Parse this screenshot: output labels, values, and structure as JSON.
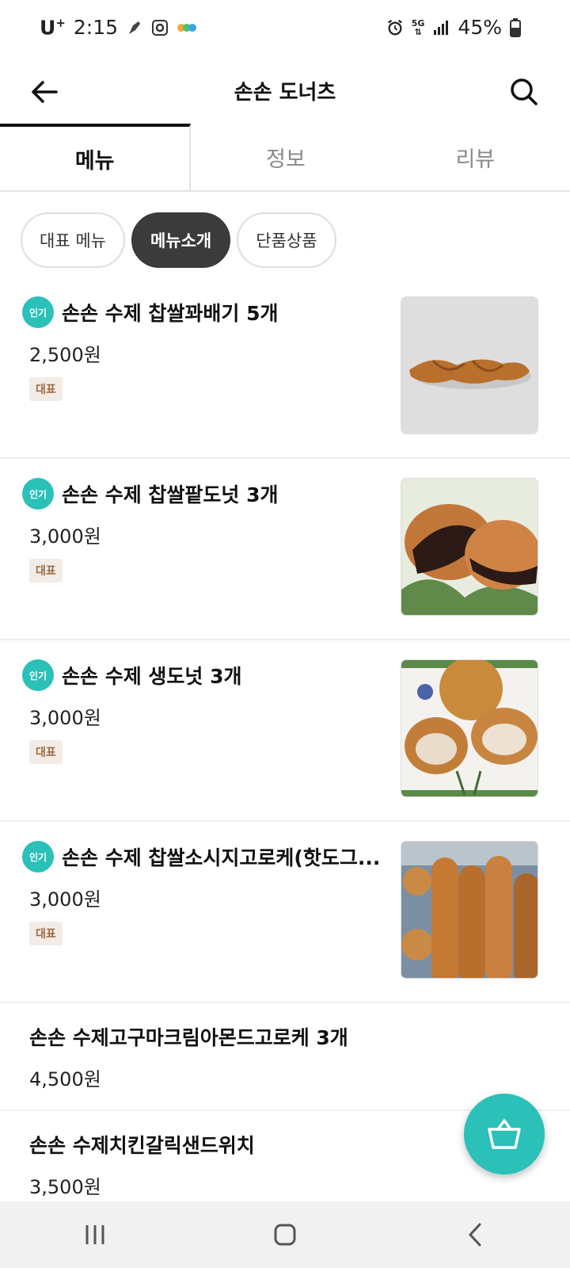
{
  "status_bar": {
    "carrier": "U",
    "carrier_sup": "+",
    "time": "2:15",
    "network": "5G",
    "battery": "45%"
  },
  "header": {
    "title": "손손 도너츠",
    "back_icon": "arrow-left-icon",
    "search_icon": "search-icon"
  },
  "tabs": [
    {
      "label": "메뉴",
      "active": true
    },
    {
      "label": "정보",
      "active": false
    },
    {
      "label": "리뷰",
      "active": false
    }
  ],
  "chips": [
    {
      "label": "대표 메뉴",
      "active": false
    },
    {
      "label": "메뉴소개",
      "active": true
    },
    {
      "label": "단품상품",
      "active": false
    }
  ],
  "popular_label": "인기",
  "representative_label": "대표",
  "menu": [
    {
      "name": "손손 수제 찹쌀꽈배기 5개",
      "price": "2,500원"
    },
    {
      "name": "손손 수제 찹쌀팥도넛 3개",
      "price": "3,000원"
    },
    {
      "name": "손손 수제 생도넛 3개",
      "price": "3,000원"
    },
    {
      "name": "손손 수제 찹쌀소시지고로케(핫도그...",
      "price": "3,000원"
    },
    {
      "name": "손손 수제고구마크림아몬드고로케 3개",
      "price": "4,500원"
    },
    {
      "name": "손손 수제치킨갈릭샌드위치",
      "price": "3,500원"
    }
  ],
  "colors": {
    "accent": "#2bc0b8",
    "chip_active": "#3b3b3b",
    "badge_bg": "#f3ece6",
    "badge_text": "#9b6a42"
  }
}
